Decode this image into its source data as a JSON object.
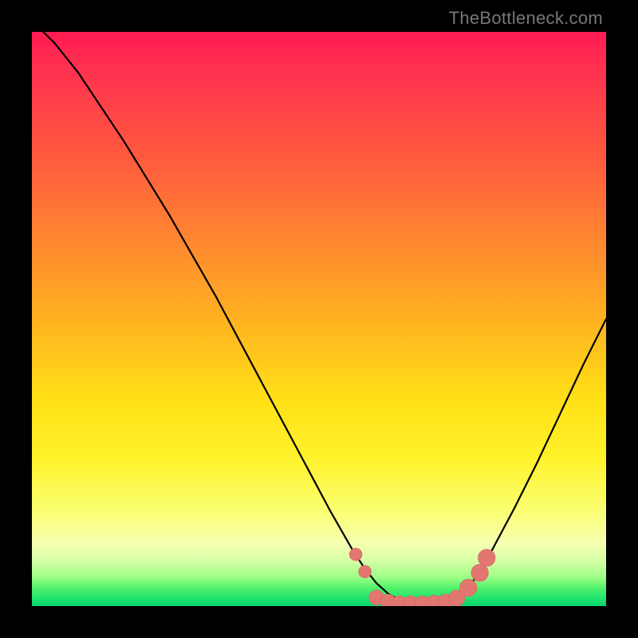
{
  "watermark": "TheBottleneck.com",
  "colors": {
    "page_bg": "#000000",
    "watermark": "#777777",
    "curve": "#000000",
    "marker_fill": "#e27670",
    "marker_stroke": "#d9645e"
  },
  "chart_data": {
    "type": "line",
    "title": "",
    "xlabel": "",
    "ylabel": "",
    "xlim": [
      0,
      100
    ],
    "ylim": [
      0,
      100
    ],
    "grid": false,
    "legend": false,
    "series": [
      {
        "name": "bottleneck-curve",
        "x": [
          0,
          4,
          8,
          12,
          16,
          20,
          24,
          28,
          32,
          36,
          40,
          44,
          48,
          52,
          56,
          58,
          60,
          62,
          64,
          66,
          68,
          70,
          72,
          74,
          76,
          78,
          80,
          84,
          88,
          92,
          96,
          100
        ],
        "y": [
          102,
          98,
          93,
          87,
          81,
          74.5,
          68,
          61,
          54,
          46.5,
          39,
          31.5,
          24,
          16.5,
          9.5,
          6.5,
          4,
          2.2,
          1,
          0.3,
          0,
          0,
          0.3,
          1.3,
          3.2,
          6,
          9.5,
          17,
          25,
          33.5,
          42,
          50
        ]
      }
    ],
    "markers": [
      {
        "x": 56.4,
        "y": 9.0,
        "r": 1.1
      },
      {
        "x": 58.0,
        "y": 6.0,
        "r": 1.1
      },
      {
        "x": 60.0,
        "y": 1.5,
        "r": 1.3
      },
      {
        "x": 62.0,
        "y": 0.8,
        "r": 1.3
      },
      {
        "x": 64.0,
        "y": 0.5,
        "r": 1.3
      },
      {
        "x": 66.0,
        "y": 0.5,
        "r": 1.3
      },
      {
        "x": 68.0,
        "y": 0.5,
        "r": 1.3
      },
      {
        "x": 70.0,
        "y": 0.6,
        "r": 1.3
      },
      {
        "x": 72.0,
        "y": 0.8,
        "r": 1.3
      },
      {
        "x": 74.0,
        "y": 1.4,
        "r": 1.4
      },
      {
        "x": 76.0,
        "y": 3.2,
        "r": 1.5
      },
      {
        "x": 78.0,
        "y": 5.8,
        "r": 1.5
      },
      {
        "x": 79.2,
        "y": 8.4,
        "r": 1.5
      }
    ],
    "background_gradient": {
      "direction": "vertical",
      "stops": [
        {
          "pos": 0.0,
          "color": "#ff1a52"
        },
        {
          "pos": 0.22,
          "color": "#ff5a3e"
        },
        {
          "pos": 0.52,
          "color": "#ffb81f"
        },
        {
          "pos": 0.74,
          "color": "#fff22a"
        },
        {
          "pos": 0.89,
          "color": "#f6ffb0"
        },
        {
          "pos": 0.97,
          "color": "#4cf06a"
        },
        {
          "pos": 1.0,
          "color": "#08d66a"
        }
      ]
    }
  }
}
